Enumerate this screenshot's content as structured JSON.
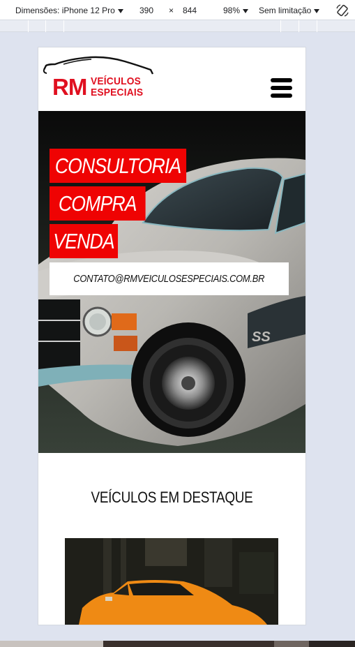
{
  "devtools": {
    "device_label": "Dimensões: iPhone 12 Pro",
    "width_value": "390",
    "times_sign": "×",
    "height_value": "844",
    "zoom_value": "98%",
    "throttle_label": "Sem limitação"
  },
  "site": {
    "logo": {
      "initials": "RM",
      "line1": "VEÍCULOS",
      "line2": "ESPECIAIS"
    },
    "menu_icon": "hamburger-menu-icon",
    "hero": {
      "tags": [
        "CONSULTORIA",
        "COMPRA",
        "VENDA"
      ],
      "contact_email": "CONTATO@RMVEICULOSESPECIAIS.COM.BR"
    },
    "featured_title": "VEÍCULOS EM DESTAQUE"
  },
  "colors": {
    "brand_red": "#e01020",
    "tag_red": "#ef0303",
    "devtools_bg": "#dee3ef"
  }
}
